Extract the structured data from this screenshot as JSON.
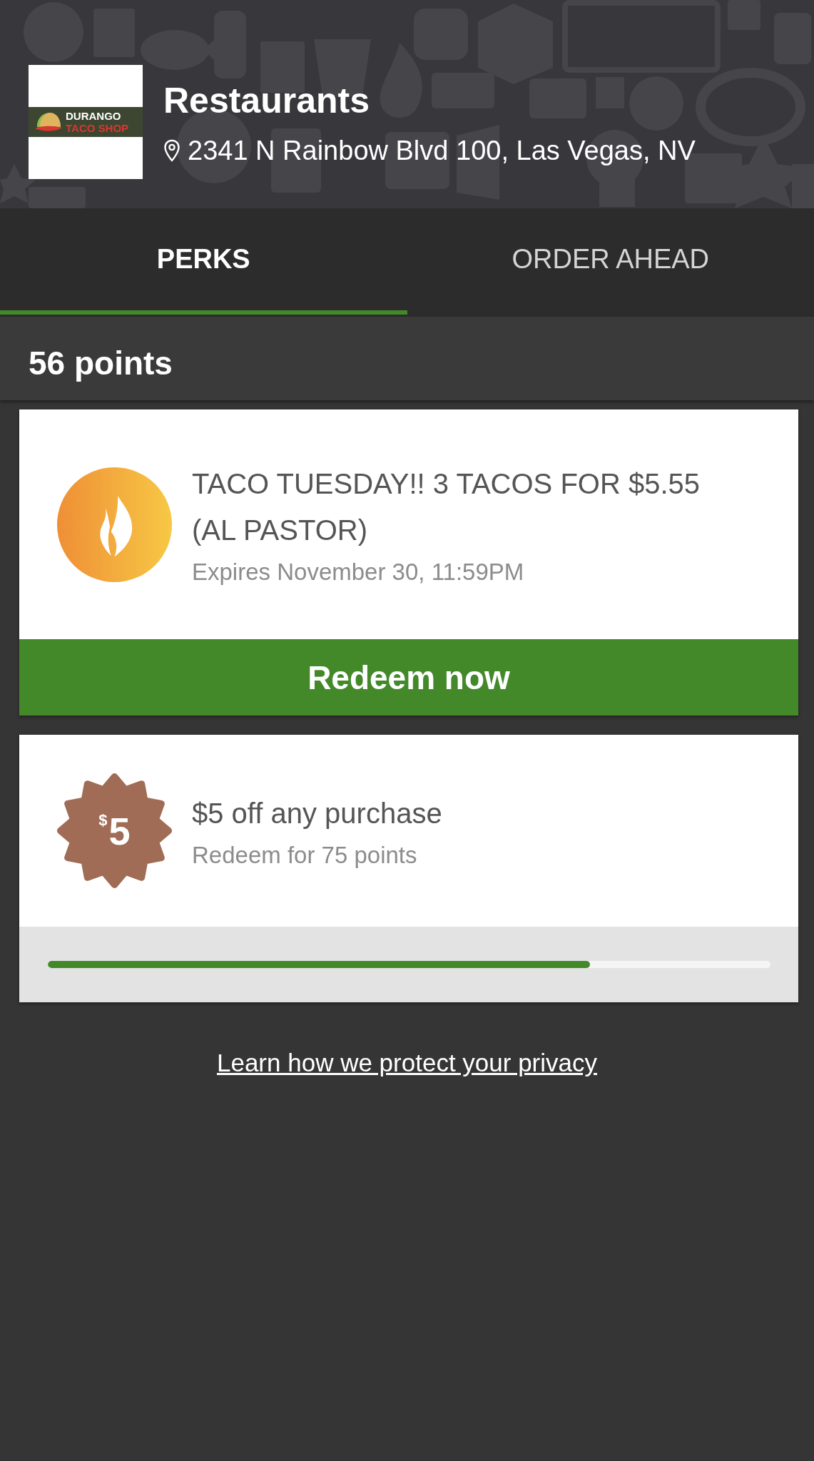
{
  "header": {
    "logo": {
      "line_1": "DURANGO",
      "line_2": "TACO SHOP"
    },
    "title": "Restaurants",
    "address": "2341 N Rainbow Blvd 100, Las Vegas, NV"
  },
  "tabs": [
    {
      "label": "PERKS",
      "selected": true
    },
    {
      "label": "ORDER AHEAD",
      "selected": false
    }
  ],
  "points": "56 points",
  "rewards": [
    {
      "kind": "deal",
      "title": "TACO TUESDAY!! 3 TACOS FOR $5.55 (AL PASTOR)",
      "subtitle": "Expires November 30, 11:59PM",
      "button": "Redeem now"
    },
    {
      "kind": "points",
      "badge_currency": "$",
      "badge_amount": "5",
      "title": "$5 off any purchase",
      "subtitle": "Redeem for 75 points",
      "level": 0.75
    }
  ],
  "privacy_link": "Learn how we protect your privacy"
}
